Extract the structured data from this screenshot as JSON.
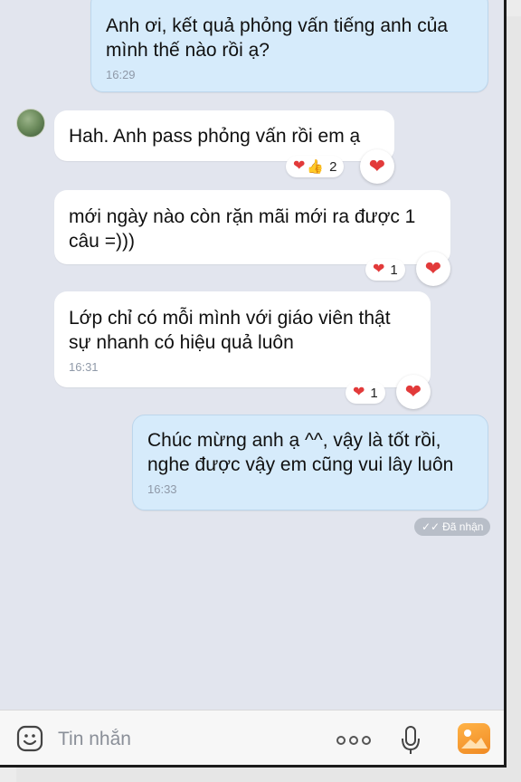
{
  "messages": [
    {
      "id": "m1",
      "direction": "out",
      "text": "Anh ơi, kết quả phỏng vấn tiếng anh của mình thế nào rồi ạ?",
      "time": "16:29"
    },
    {
      "id": "m2",
      "direction": "in",
      "text": "Hah. Anh pass phỏng vấn rồi em ạ",
      "time": "",
      "reactions": {
        "summary_count": "2",
        "emojis": [
          "heart",
          "thumbs-up"
        ]
      }
    },
    {
      "id": "m3",
      "direction": "in",
      "text": "mới ngày nào còn rặn mãi mới ra được 1 câu =)))",
      "time": "",
      "reactions": {
        "summary_count": "1",
        "emojis": [
          "heart"
        ]
      }
    },
    {
      "id": "m4",
      "direction": "in",
      "text": "Lớp chỉ có mỗi mình với giáo viên thật sự nhanh có hiệu quả luôn",
      "time": "16:31",
      "reactions": {
        "summary_count": "1",
        "emojis": [
          "heart"
        ]
      }
    },
    {
      "id": "m5",
      "direction": "out",
      "text": "Chúc mừng anh ạ ^^, vậy là tốt rồi, nghe được vậy em cũng vui lây luôn",
      "time": "16:33"
    }
  ],
  "delivery_status": "Đã nhận",
  "composer": {
    "placeholder": "Tin nhắn",
    "icons": [
      "emoji-icon",
      "more-icon",
      "microphone-icon",
      "image-icon"
    ]
  },
  "colors": {
    "chat_bg": "#e2e5ee",
    "outgoing_bubble": "#d6ebfb",
    "incoming_bubble": "#ffffff",
    "heart": "#e23a3a",
    "image_icon": "#f39a2c"
  }
}
